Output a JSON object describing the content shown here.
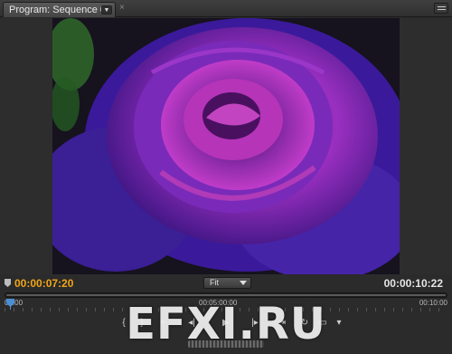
{
  "panel": {
    "tab_label": "Program: Sequence 01",
    "close_glyph": "×"
  },
  "playback": {
    "current_timecode": "00:00:07:20",
    "total_duration": "00:00:10:22",
    "zoom_option": "Fit"
  },
  "ruler": {
    "labels": [
      "00:00",
      "00:05:00:00",
      "00:10:00"
    ]
  },
  "controls": {
    "buttons": [
      {
        "name": "set-in-point",
        "glyph": "{"
      },
      {
        "name": "set-out-point",
        "glyph": "}"
      },
      {
        "name": "go-to-in",
        "glyph": "⇤"
      },
      {
        "name": "step-back",
        "glyph": "◂|"
      },
      {
        "name": "play",
        "glyph": "▶"
      },
      {
        "name": "step-forward",
        "glyph": "|▸"
      },
      {
        "name": "go-to-out",
        "glyph": "⇥"
      },
      {
        "name": "loop",
        "glyph": "↻"
      },
      {
        "name": "safe-margins",
        "glyph": "▭"
      },
      {
        "name": "output",
        "glyph": "▾"
      }
    ]
  },
  "watermark": "EFXI.RU",
  "colors": {
    "current_timecode": "#f2a516",
    "panel_bg": "#2b2b2b"
  }
}
